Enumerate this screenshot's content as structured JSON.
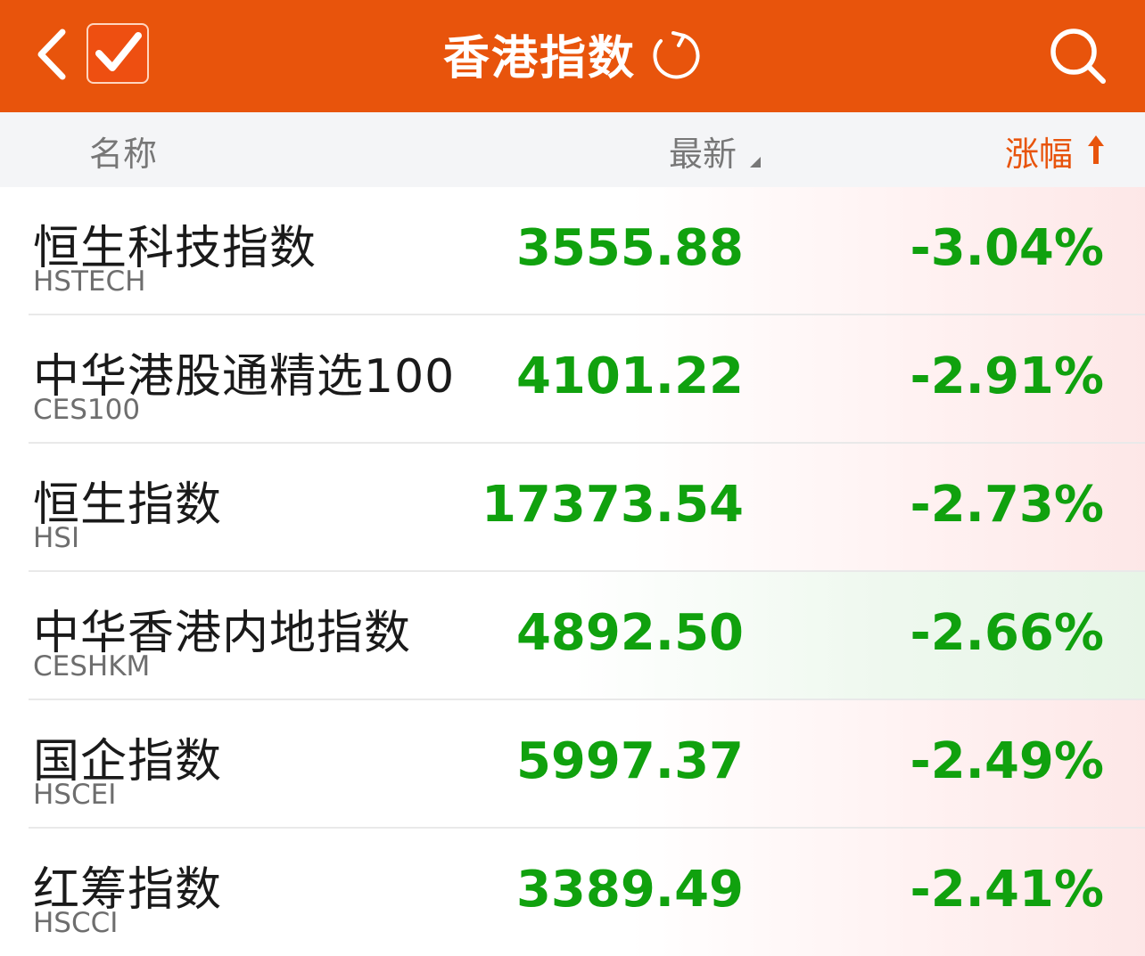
{
  "header": {
    "title": "香港指数",
    "back_icon": "chevron-left-icon",
    "check_icon": "checkmark-icon",
    "refresh_icon": "refresh-icon",
    "search_icon": "search-icon",
    "bg_color": "#e8540c"
  },
  "columns": {
    "name": "名称",
    "latest": "最新",
    "change": "涨幅",
    "change_sort_icon": "arrow-up-icon",
    "latest_sort_icon": "sort-triangle-icon"
  },
  "rows": [
    {
      "name": "恒生科技指数",
      "code": "HSTECH",
      "price": "3555.88",
      "change": "-3.04%"
    },
    {
      "name": "中华港股通精选100",
      "code": "CES100",
      "price": "4101.22",
      "change": "-2.91%"
    },
    {
      "name": "恒生指数",
      "code": "HSI",
      "price": "17373.54",
      "change": "-2.73%"
    },
    {
      "name": "中华香港内地指数",
      "code": "CESHKM",
      "price": "4892.50",
      "change": "-2.66%"
    },
    {
      "name": "国企指数",
      "code": "HSCEI",
      "price": "5997.37",
      "change": "-2.49%"
    },
    {
      "name": "红筹指数",
      "code": "HSCCI",
      "price": "3389.49",
      "change": "-2.41%"
    }
  ],
  "colors": {
    "down": "#10a10e",
    "accent": "#e8540c"
  }
}
